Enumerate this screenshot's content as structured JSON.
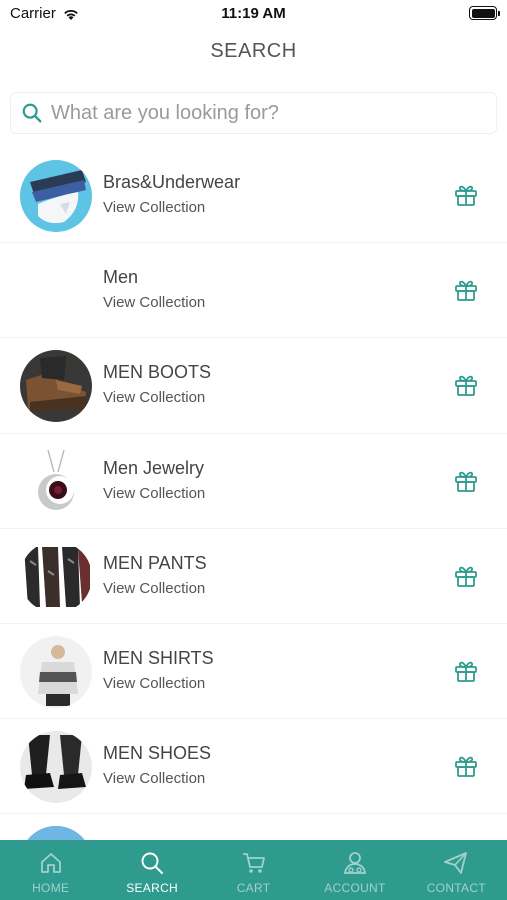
{
  "status": {
    "carrier": "Carrier",
    "time": "11:19 AM"
  },
  "header": {
    "title": "SEARCH"
  },
  "search": {
    "placeholder": "What are you looking for?"
  },
  "colors": {
    "accent": "#2f9b8f",
    "icon": "#2f9b8f",
    "tab_inactive": "#9fd2cc"
  },
  "collections": {
    "items": [
      {
        "title": "Bras&Underwear",
        "subtitle": "View Collection"
      },
      {
        "title": "Men",
        "subtitle": "View Collection"
      },
      {
        "title": "MEN BOOTS",
        "subtitle": "View Collection"
      },
      {
        "title": "Men Jewelry",
        "subtitle": "View Collection"
      },
      {
        "title": "MEN PANTS",
        "subtitle": "View Collection"
      },
      {
        "title": "MEN SHIRTS",
        "subtitle": "View Collection"
      },
      {
        "title": "MEN SHOES",
        "subtitle": "View Collection"
      }
    ]
  },
  "tabbar": {
    "tabs": [
      {
        "label": "HOME",
        "icon": "home-icon"
      },
      {
        "label": "SEARCH",
        "icon": "search-icon"
      },
      {
        "label": "CART",
        "icon": "cart-icon"
      },
      {
        "label": "ACCOUNT",
        "icon": "account-icon"
      },
      {
        "label": "CONTACT",
        "icon": "send-icon"
      }
    ]
  }
}
